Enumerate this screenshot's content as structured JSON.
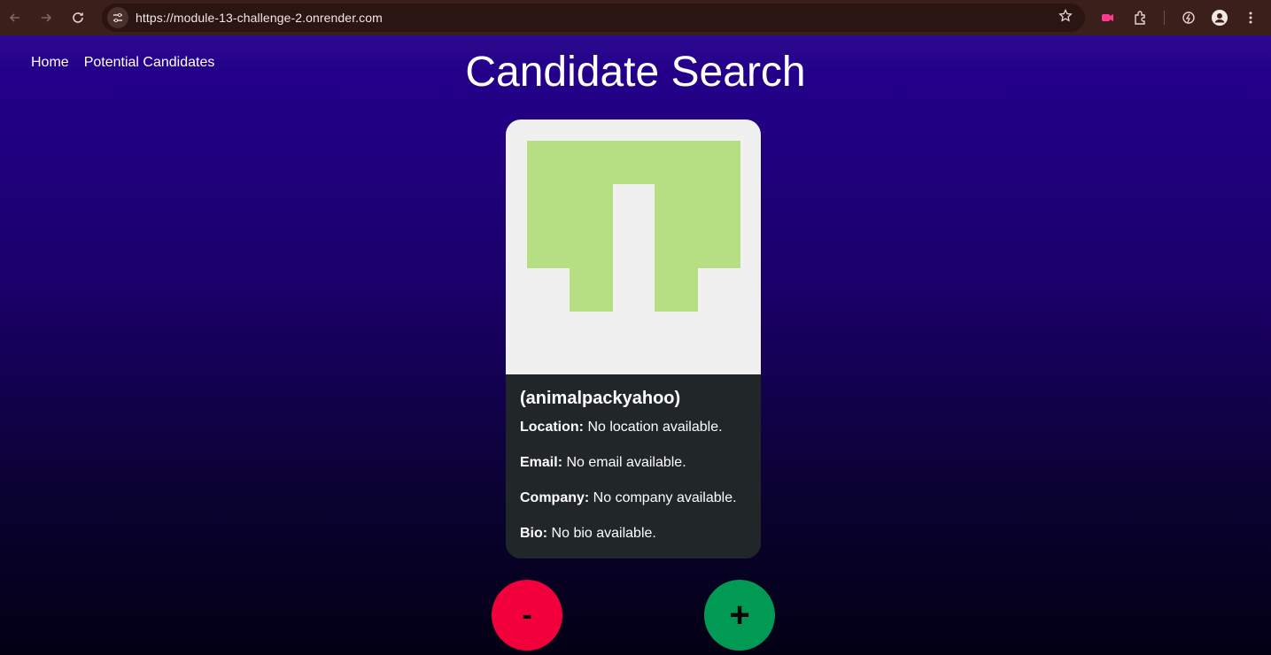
{
  "browser": {
    "url": "https://module-13-challenge-2.onrender.com"
  },
  "nav": {
    "home": "Home",
    "potential_candidates": "Potential Candidates"
  },
  "page": {
    "title": "Candidate Search"
  },
  "candidate": {
    "login": "(animalpackyahoo)",
    "location_label": "Location:",
    "location_value": " No location available.",
    "email_label": "Email:",
    "email_value": " No email available.",
    "company_label": "Company:",
    "company_value": " No company available.",
    "bio_label": "Bio:",
    "bio_value": " No bio available."
  },
  "actions": {
    "reject_label": "-",
    "accept_label": "+"
  },
  "colors": {
    "reject": "#f2003c",
    "accept": "#009a55",
    "avatar_fill": "#b6de82",
    "card_bg": "#212629"
  }
}
